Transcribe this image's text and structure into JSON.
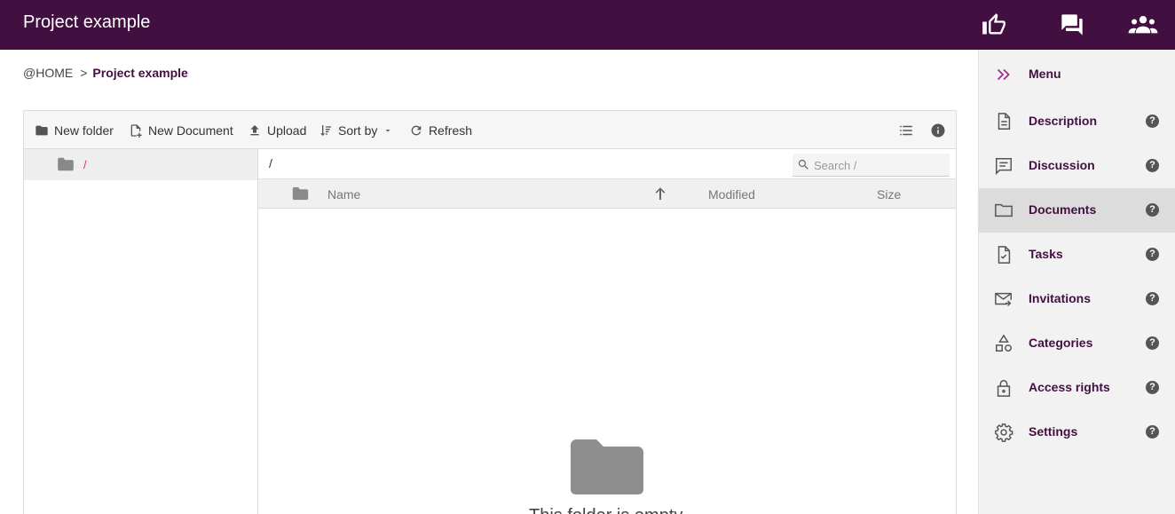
{
  "header": {
    "title": "Project example",
    "icons": [
      "thumbs-up-icon",
      "forum-icon",
      "people-icon"
    ]
  },
  "breadcrumb": {
    "home": "@HOME",
    "separator": ">",
    "current": "Project example"
  },
  "toolbar": {
    "new_folder": "New folder",
    "new_document": "New Document",
    "upload": "Upload",
    "sort_by": "Sort by",
    "refresh": "Refresh"
  },
  "tree": {
    "root_label": "/"
  },
  "pathbar": {
    "path": "/",
    "search_placeholder": "Search /"
  },
  "columns": {
    "name": "Name",
    "modified": "Modified",
    "size": "Size",
    "sort_direction": "ascending"
  },
  "empty_state": {
    "message": "This folder is empty"
  },
  "sidebar": {
    "menu_label": "Menu",
    "items": [
      {
        "label": "Description",
        "icon": "document-icon",
        "active": false
      },
      {
        "label": "Discussion",
        "icon": "chat-icon",
        "active": false
      },
      {
        "label": "Documents",
        "icon": "folder-icon",
        "active": true
      },
      {
        "label": "Tasks",
        "icon": "task-icon",
        "active": false
      },
      {
        "label": "Invitations",
        "icon": "mail-icon",
        "active": false
      },
      {
        "label": "Categories",
        "icon": "shapes-icon",
        "active": false
      },
      {
        "label": "Access rights",
        "icon": "lock-icon",
        "active": false
      },
      {
        "label": "Settings",
        "icon": "gear-icon",
        "active": false
      }
    ],
    "help_symbol": "?"
  },
  "colors": {
    "brand": "#421040",
    "accent": "#a0308f",
    "tree_root_label": "#e0353c"
  }
}
